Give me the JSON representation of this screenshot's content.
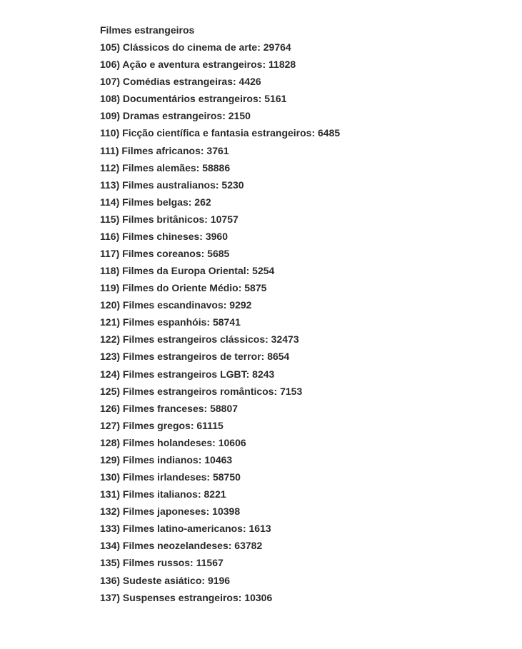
{
  "title": "Filmes estrangeiros",
  "items": [
    {
      "num": "105",
      "label": "Clássicos do cinema de arte",
      "code": "29764"
    },
    {
      "num": "106",
      "label": "Ação e aventura estrangeiros",
      "code": "11828"
    },
    {
      "num": "107",
      "label": "Comédias estrangeiras",
      "code": "4426"
    },
    {
      "num": "108",
      "label": "Documentários estrangeiros",
      "code": "5161"
    },
    {
      "num": "109",
      "label": "Dramas estrangeiros",
      "code": "2150"
    },
    {
      "num": "110",
      "label": "Ficção científica e fantasia estrangeiros",
      "code": "6485"
    },
    {
      "num": "111",
      "label": "Filmes africanos",
      "code": "3761"
    },
    {
      "num": "112",
      "label": "Filmes alemães",
      "code": "58886"
    },
    {
      "num": "113",
      "label": "Filmes australianos",
      "code": "5230"
    },
    {
      "num": "114",
      "label": "Filmes belgas",
      "code": "262"
    },
    {
      "num": "115",
      "label": "Filmes britânicos",
      "code": "10757"
    },
    {
      "num": "116",
      "label": "Filmes chineses",
      "code": "3960"
    },
    {
      "num": "117",
      "label": "Filmes coreanos",
      "code": "5685"
    },
    {
      "num": "118",
      "label": "Filmes da Europa Oriental",
      "code": "5254"
    },
    {
      "num": "119",
      "label": "Filmes do Oriente Médio",
      "code": "5875"
    },
    {
      "num": "120",
      "label": "Filmes escandinavos",
      "code": "9292"
    },
    {
      "num": "121",
      "label": "Filmes espanhóis",
      "code": "58741"
    },
    {
      "num": "122",
      "label": "Filmes estrangeiros clássicos",
      "code": "32473"
    },
    {
      "num": "123",
      "label": "Filmes estrangeiros de terror",
      "code": "8654"
    },
    {
      "num": "124",
      "label": "Filmes estrangeiros LGBT",
      "code": "8243"
    },
    {
      "num": "125",
      "label": "Filmes estrangeiros românticos",
      "code": "7153"
    },
    {
      "num": "126",
      "label": "Filmes franceses",
      "code": "58807"
    },
    {
      "num": "127",
      "label": "Filmes gregos",
      "code": "61115"
    },
    {
      "num": "128",
      "label": "Filmes holandeses",
      "code": "10606"
    },
    {
      "num": "129",
      "label": "Filmes indianos",
      "code": "10463"
    },
    {
      "num": "130",
      "label": "Filmes irlandeses",
      "code": "58750"
    },
    {
      "num": "131",
      "label": "Filmes italianos",
      "code": "8221"
    },
    {
      "num": "132",
      "label": "Filmes japoneses",
      "code": "10398"
    },
    {
      "num": "133",
      "label": "Filmes latino-americanos",
      "code": "1613"
    },
    {
      "num": "134",
      "label": "Filmes neozelandeses",
      "code": "63782"
    },
    {
      "num": "135",
      "label": "Filmes russos",
      "code": "11567"
    },
    {
      "num": "136",
      "label": "Sudeste asiático",
      "code": "9196"
    },
    {
      "num": "137",
      "label": "Suspenses estrangeiros",
      "code": "10306"
    }
  ]
}
